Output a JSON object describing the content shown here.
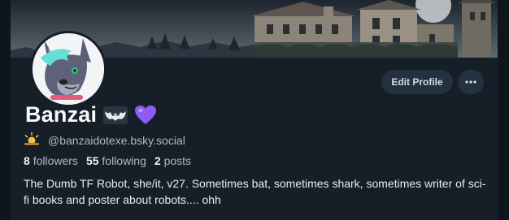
{
  "profile": {
    "display_name": "Banzai",
    "handle": "@banzaidotexe.bsky.social",
    "bio": "The Dumb TF Robot, she/it, v27. Sometimes bat, sometimes shark, sometimes writer of sci-fi books and poster about robots.... ohh",
    "name_emojis": [
      "bat-emoji-icon",
      "purple-heart-icon"
    ],
    "handle_prefix_icon": "sun-behind-cloud-icon"
  },
  "stats": {
    "followers_count": "8",
    "followers_label": "followers",
    "following_count": "55",
    "following_label": "following",
    "posts_count": "2",
    "posts_label": "posts"
  },
  "actions": {
    "edit_label": "Edit Profile",
    "more_icon": "ellipsis-icon"
  },
  "colors": {
    "background": "#161e27",
    "button_bg": "#243140",
    "muted_text": "#aeb9c5",
    "heart": "#8b5cf6"
  }
}
